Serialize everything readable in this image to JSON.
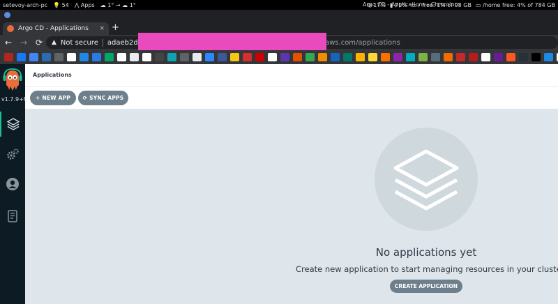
{
  "os_bar": {
    "hostname": "setevoy-arch-pc",
    "updates": "54",
    "apps_label": "Apps",
    "weather_a": "1°",
    "weather_b": "1°",
    "window_title": "Argo CD - Applications - Chromium",
    "cpu": "17%",
    "battery": "71%",
    "disk_root": "/ free: 1% of 98 GB",
    "disk_home": "/home free: 4% of 784 GB"
  },
  "browser": {
    "tab_title": "Argo CD - Applications",
    "tab_close": "×",
    "new_tab": "+",
    "not_secure": "Not secure",
    "url_host": "adaeb2dd49",
    "url_tail": "aws.com",
    "url_path": "/applications",
    "bookmark_colors": [
      "#b3261e",
      "#1877f2",
      "#4285f4",
      "#2b6cb0",
      "#5f6368",
      "#ffffff",
      "#1e88e5",
      "#2c7be5",
      "#00a86b",
      "#ffffff",
      "#e8eaed",
      "#ffffff",
      "#444",
      "#0fa3b1",
      "#5f6368",
      "#e8eaed",
      "#2d88ff",
      "#3b5998",
      "#f5c518",
      "#d32f2f",
      "#c00",
      "#ffffff",
      "#5e35b1",
      "#e65100",
      "#34a853",
      "#f28b00",
      "#1565c0",
      "#00796b",
      "#ffb300",
      "#fdd835",
      "#ff6f00",
      "#8e24aa",
      "#00acc1",
      "#7cb342",
      "#546e7a",
      "#ef6c00",
      "#c62828",
      "#b71c1c",
      "#ffffff",
      "#6a1b9a",
      "#ff5722",
      "#263238",
      "#000",
      "#1e88e5",
      "#fafafa",
      "#1976d2"
    ]
  },
  "sidebar": {
    "version": "v1.7.9+f",
    "colors": {
      "bg": "#0d1c24",
      "accent": "#18be94"
    }
  },
  "main": {
    "page_title": "Applications",
    "new_app_label": "NEW APP",
    "sync_apps_label": "SYNC APPS",
    "empty_title": "No applications yet",
    "empty_desc": "Create new application to start managing resources in your cluster",
    "create_label": "CREATE APPLICATION"
  }
}
